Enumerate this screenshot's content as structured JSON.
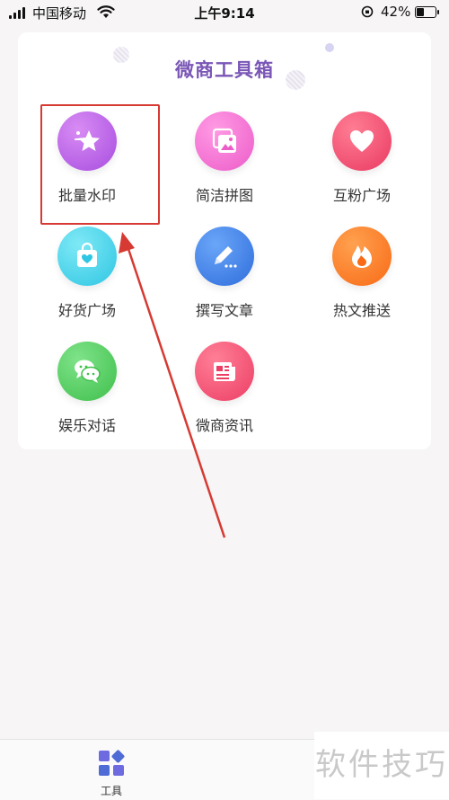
{
  "status_bar": {
    "carrier": "中国移动",
    "time": "上午9:14",
    "battery": "42%"
  },
  "card": {
    "title": "微商工具箱",
    "tools": [
      {
        "label": "批量水印",
        "icon": "star-icon",
        "color": "#b65be0"
      },
      {
        "label": "简洁拼图",
        "icon": "gallery-icon",
        "color": "#f06fd0"
      },
      {
        "label": "互粉广场",
        "icon": "heart-icon",
        "color": "#ef4a6c"
      },
      {
        "label": "好货广场",
        "icon": "shopping-bag-icon",
        "color": "#3fd2e8"
      },
      {
        "label": "撰写文章",
        "icon": "pencil-icon",
        "color": "#3f7fe6"
      },
      {
        "label": "热文推送",
        "icon": "flame-icon",
        "color": "#ff7a1f"
      },
      {
        "label": "娱乐对话",
        "icon": "chat-icon",
        "color": "#4ccd58"
      },
      {
        "label": "微商资讯",
        "icon": "news-icon",
        "color": "#f24c6d"
      }
    ]
  },
  "bottom_nav": {
    "tab_label": "工具"
  },
  "watermark": "软件技巧"
}
